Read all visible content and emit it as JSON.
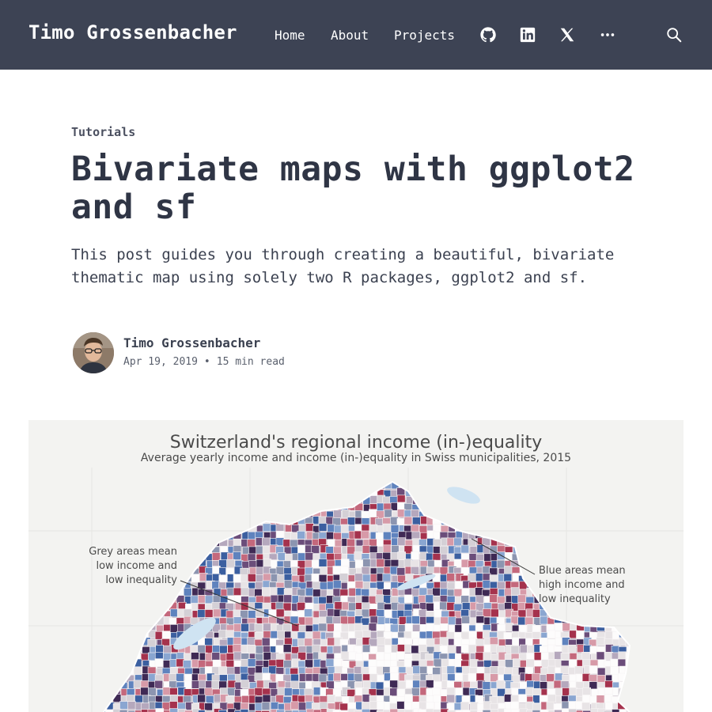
{
  "header": {
    "brand": "Timo Grossenbacher",
    "nav": [
      "Home",
      "About",
      "Projects"
    ],
    "icons": [
      "github-icon",
      "linkedin-icon",
      "x-icon",
      "more-icon",
      "search-icon"
    ]
  },
  "post": {
    "category": "Tutorials",
    "title": "Bivariate maps with ggplot2 and sf",
    "summary": "This post guides you through creating a beautiful, bivariate thematic map using solely two R packages, ggplot2 and sf.",
    "author": "Timo Grossenbacher",
    "date": "Apr 19, 2019",
    "separator": "•",
    "read_time": "15 min read"
  },
  "figure": {
    "title": "Switzerland's regional income (in-)equality",
    "subtitle": "Average yearly income and income (in-)equality in Swiss municipalities, 2015",
    "annotation_left": [
      "Grey areas mean",
      "low income and",
      "low inequality"
    ],
    "annotation_right": [
      "Blue areas mean",
      "high income and",
      "low inequality"
    ]
  },
  "colors": {
    "header_bg": "#3d4354",
    "text_dark": "#2f3545",
    "figure_bg": "#f3f3f1",
    "bivar_blue": "#3b5fa0",
    "bivar_red": "#a5324d",
    "bivar_purple": "#3f2a55",
    "bivar_grey": "#d4d0d6"
  }
}
